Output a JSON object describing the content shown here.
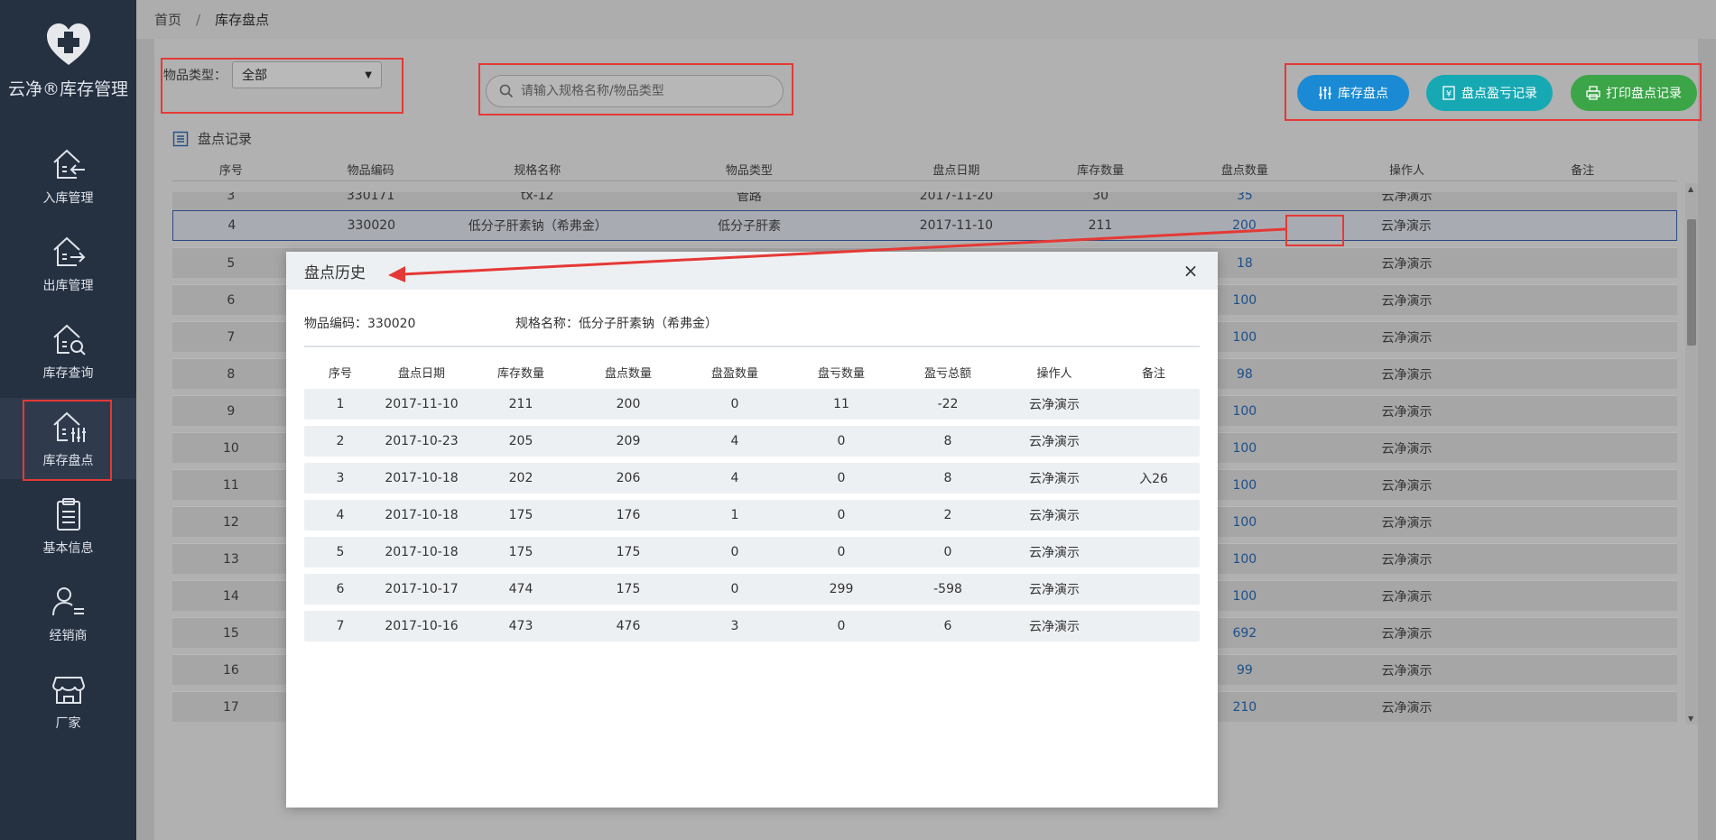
{
  "app": {
    "title": "云净®库存管理"
  },
  "sidebar": {
    "items": [
      {
        "label": "入库管理",
        "icon": "house-in-arrow-icon"
      },
      {
        "label": "出库管理",
        "icon": "house-out-arrow-icon"
      },
      {
        "label": "库存查询",
        "icon": "house-search-icon"
      },
      {
        "label": "库存盘点",
        "icon": "house-sliders-icon",
        "active": true
      },
      {
        "label": "基本信息",
        "icon": "clipboard-icon"
      },
      {
        "label": "经销商",
        "icon": "user-list-icon"
      },
      {
        "label": "厂家",
        "icon": "store-icon"
      }
    ]
  },
  "breadcrumb": {
    "home": "首页",
    "separator": "/",
    "current": "库存盘点"
  },
  "filter": {
    "label": "物品类型：",
    "value": "全部"
  },
  "search": {
    "placeholder": "请输入规格名称/物品类型"
  },
  "toolbar": {
    "inventory_label": "库存盘点",
    "records_label": "盘点盈亏记录",
    "print_label": "打印盘点记录"
  },
  "records": {
    "title": "盘点记录",
    "columns": [
      "序号",
      "物品编码",
      "规格名称",
      "物品类型",
      "盘点日期",
      "库存数量",
      "盘点数量",
      "操作人",
      "备注"
    ],
    "rows": [
      [
        "3",
        "330171",
        "tx-12",
        "管路",
        "2017-11-20",
        "30",
        "35",
        "云净演示",
        ""
      ],
      [
        "4",
        "330020",
        "低分子肝素钠（希弗金）",
        "低分子肝素",
        "2017-11-10",
        "211",
        "200",
        "云净演示",
        ""
      ],
      [
        "5",
        "",
        "",
        "",
        "",
        "",
        "18",
        "云净演示",
        ""
      ],
      [
        "6",
        "",
        "",
        "",
        "",
        "",
        "100",
        "云净演示",
        ""
      ],
      [
        "7",
        "",
        "",
        "",
        "",
        "",
        "100",
        "云净演示",
        ""
      ],
      [
        "8",
        "",
        "",
        "",
        "",
        "",
        "98",
        "云净演示",
        ""
      ],
      [
        "9",
        "",
        "",
        "",
        "",
        "",
        "100",
        "云净演示",
        ""
      ],
      [
        "10",
        "",
        "",
        "",
        "",
        "",
        "100",
        "云净演示",
        ""
      ],
      [
        "11",
        "",
        "",
        "",
        "",
        "",
        "100",
        "云净演示",
        ""
      ],
      [
        "12",
        "",
        "",
        "",
        "",
        "",
        "100",
        "云净演示",
        ""
      ],
      [
        "13",
        "",
        "",
        "",
        "",
        "",
        "100",
        "云净演示",
        ""
      ],
      [
        "14",
        "",
        "",
        "",
        "",
        "",
        "100",
        "云净演示",
        ""
      ],
      [
        "15",
        "",
        "",
        "",
        "",
        "",
        "692",
        "云净演示",
        ""
      ],
      [
        "16",
        "",
        "",
        "",
        "",
        "",
        "99",
        "云净演示",
        ""
      ],
      [
        "17",
        "",
        "",
        "",
        "",
        "",
        "210",
        "云净演示",
        ""
      ]
    ]
  },
  "modal": {
    "title": "盘点历史",
    "close": "×",
    "item_code": "物品编码：330020",
    "spec_name": "规格名称：低分子肝素钠（希弗金）",
    "columns": [
      "序号",
      "盘点日期",
      "库存数量",
      "盘点数量",
      "盘盈数量",
      "盘亏数量",
      "盈亏总额",
      "操作人",
      "备注"
    ],
    "rows": [
      [
        "1",
        "2017-11-10",
        "211",
        "200",
        "0",
        "11",
        "-22",
        "云净演示",
        ""
      ],
      [
        "2",
        "2017-10-23",
        "205",
        "209",
        "4",
        "0",
        "8",
        "云净演示",
        ""
      ],
      [
        "3",
        "2017-10-18",
        "202",
        "206",
        "4",
        "0",
        "8",
        "云净演示",
        "入26"
      ],
      [
        "4",
        "2017-10-18",
        "175",
        "176",
        "1",
        "0",
        "2",
        "云净演示",
        ""
      ],
      [
        "5",
        "2017-10-18",
        "175",
        "175",
        "0",
        "0",
        "0",
        "云净演示",
        ""
      ],
      [
        "6",
        "2017-10-17",
        "474",
        "175",
        "0",
        "299",
        "-598",
        "云净演示",
        ""
      ],
      [
        "7",
        "2017-10-16",
        "473",
        "476",
        "3",
        "0",
        "6",
        "云净演示",
        ""
      ]
    ]
  },
  "colors": {
    "sidebar_bg": "#253041",
    "btn_inventory": "#1a8ad4",
    "btn_records": "#17a9b3",
    "btn_print": "#3ba548",
    "annotation_red": "#e53935"
  }
}
